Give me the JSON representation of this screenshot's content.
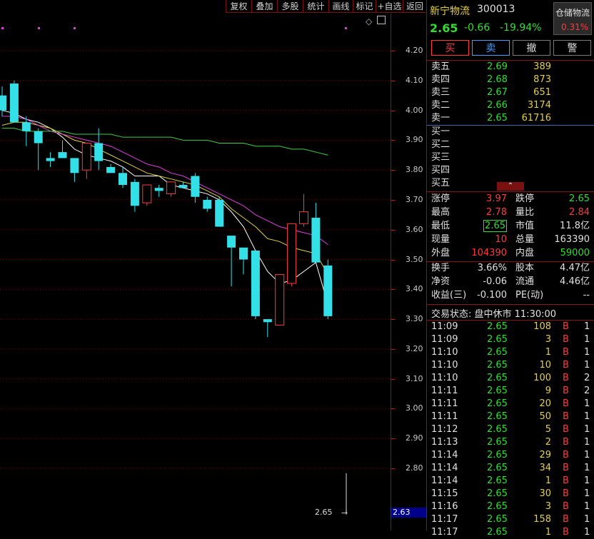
{
  "toolbar": {
    "items": [
      "复权",
      "叠加",
      "多股",
      "统计",
      "画线",
      "标记",
      "+自选",
      "返回"
    ]
  },
  "axis": {
    "labels": [
      "4.20",
      "4.10",
      "4.00",
      "3.90",
      "3.80",
      "3.70",
      "3.60",
      "3.50",
      "3.40",
      "3.30",
      "3.20",
      "3.10",
      "3.00",
      "2.90",
      "2.80"
    ],
    "current_price": "2.63",
    "last_close_marker": "2.65"
  },
  "quote": {
    "name": "新宁物流",
    "code": "300013",
    "price": "2.65",
    "change": "-0.66",
    "change_pct": "-19.94%",
    "sector": "仓储物流",
    "sector_pct": "0.31%",
    "buttons": [
      "买",
      "卖",
      "撤",
      "警"
    ]
  },
  "asks": [
    {
      "label": "卖五",
      "price": "2.69",
      "vol": "389"
    },
    {
      "label": "卖四",
      "price": "2.68",
      "vol": "873"
    },
    {
      "label": "卖三",
      "price": "2.67",
      "vol": "651"
    },
    {
      "label": "卖二",
      "price": "2.66",
      "vol": "3174"
    },
    {
      "label": "卖一",
      "price": "2.65",
      "vol": "61716"
    }
  ],
  "bids": [
    {
      "label": "买一"
    },
    {
      "label": "买二"
    },
    {
      "label": "买三"
    },
    {
      "label": "买四"
    },
    {
      "label": "买五"
    }
  ],
  "stats": {
    "limit_up_label": "涨停",
    "limit_up": "3.97",
    "limit_down_label": "跌停",
    "limit_down": "2.65",
    "high_label": "最高",
    "high": "2.78",
    "vol_ratio_label": "量比",
    "vol_ratio": "2.84",
    "low_label": "最低",
    "low": "2.65",
    "mktcap_label": "市值",
    "mktcap": "11.8亿",
    "cur_vol_label": "现量",
    "cur_vol": "10",
    "total_vol_label": "总量",
    "total_vol": "163390",
    "outer_label": "外盘",
    "outer": "104390",
    "inner_label": "内盘",
    "inner": "59000",
    "turnover_label": "换手",
    "turnover": "3.66%",
    "equity_label": "股本",
    "equity": "4.47亿",
    "nav_label": "净资",
    "nav": "-0.06",
    "float_label": "流通",
    "float": "4.46亿",
    "eps_label": "收益(三)",
    "eps": "-0.100",
    "pe_label": "PE(动)",
    "pe": "--"
  },
  "status_line": "交易状态: 盘中休市 11:30:00",
  "ticks": [
    {
      "t": "11:09",
      "p": "2.65",
      "v": "108",
      "s": "B",
      "n": "1"
    },
    {
      "t": "11:09",
      "p": "2.65",
      "v": "3",
      "s": "B",
      "n": "1"
    },
    {
      "t": "11:10",
      "p": "2.65",
      "v": "1",
      "s": "B",
      "n": "1"
    },
    {
      "t": "11:10",
      "p": "2.65",
      "v": "10",
      "s": "B",
      "n": "1"
    },
    {
      "t": "11:10",
      "p": "2.65",
      "v": "100",
      "s": "B",
      "n": "2"
    },
    {
      "t": "11:11",
      "p": "2.65",
      "v": "9",
      "s": "B",
      "n": "2"
    },
    {
      "t": "11:11",
      "p": "2.65",
      "v": "20",
      "s": "B",
      "n": "1"
    },
    {
      "t": "11:11",
      "p": "2.65",
      "v": "50",
      "s": "B",
      "n": "1"
    },
    {
      "t": "11:12",
      "p": "2.65",
      "v": "5",
      "s": "B",
      "n": "1"
    },
    {
      "t": "11:13",
      "p": "2.65",
      "v": "2",
      "s": "B",
      "n": "1"
    },
    {
      "t": "11:14",
      "p": "2.65",
      "v": "29",
      "s": "B",
      "n": "1"
    },
    {
      "t": "11:14",
      "p": "2.65",
      "v": "34",
      "s": "B",
      "n": "1"
    },
    {
      "t": "11:14",
      "p": "2.65",
      "v": "1",
      "s": "B",
      "n": "1"
    },
    {
      "t": "11:15",
      "p": "2.65",
      "v": "30",
      "s": "B",
      "n": "1"
    },
    {
      "t": "11:16",
      "p": "2.65",
      "v": "3",
      "s": "B",
      "n": "1"
    },
    {
      "t": "11:17",
      "p": "2.65",
      "v": "158",
      "s": "B",
      "n": "1"
    },
    {
      "t": "11:17",
      "p": "2.65",
      "v": "1",
      "s": "B",
      "n": "1"
    }
  ],
  "colors": {
    "up": "#ff3b3b",
    "down": "#33e0e8",
    "grid": "#8a1515",
    "ma5": "#ffffff",
    "ma10": "#e0d040",
    "ma20": "#e040e0",
    "ma60": "#40d040"
  },
  "chart_data": {
    "type": "candlestick",
    "ylim": [
      2.75,
      4.25
    ],
    "candles": [
      {
        "o": 4.05,
        "h": 4.08,
        "l": 3.98,
        "c": 4.0
      },
      {
        "o": 4.09,
        "h": 4.1,
        "l": 3.96,
        "c": 3.96
      },
      {
        "o": 3.96,
        "h": 3.98,
        "l": 3.88,
        "c": 3.93
      },
      {
        "o": 3.93,
        "h": 3.94,
        "l": 3.8,
        "c": 3.89
      },
      {
        "o": 3.84,
        "h": 3.86,
        "l": 3.81,
        "c": 3.83
      },
      {
        "o": 3.86,
        "h": 3.9,
        "l": 3.84,
        "c": 3.84
      },
      {
        "o": 3.84,
        "h": 3.84,
        "l": 3.76,
        "c": 3.79
      },
      {
        "o": 3.8,
        "h": 3.87,
        "l": 3.77,
        "c": 3.89
      },
      {
        "o": 3.89,
        "h": 3.94,
        "l": 3.8,
        "c": 3.83
      },
      {
        "o": 3.81,
        "h": 3.82,
        "l": 3.79,
        "c": 3.79
      },
      {
        "o": 3.79,
        "h": 3.81,
        "l": 3.74,
        "c": 3.75
      },
      {
        "o": 3.76,
        "h": 3.77,
        "l": 3.66,
        "c": 3.68
      },
      {
        "o": 3.69,
        "h": 3.75,
        "l": 3.68,
        "c": 3.75
      },
      {
        "o": 3.74,
        "h": 3.75,
        "l": 3.71,
        "c": 3.73
      },
      {
        "o": 3.72,
        "h": 3.76,
        "l": 3.71,
        "c": 3.76
      },
      {
        "o": 3.75,
        "h": 3.76,
        "l": 3.74,
        "c": 3.74
      },
      {
        "o": 3.78,
        "h": 3.79,
        "l": 3.69,
        "c": 3.71
      },
      {
        "o": 3.7,
        "h": 3.71,
        "l": 3.66,
        "c": 3.67
      },
      {
        "o": 3.7,
        "h": 3.71,
        "l": 3.61,
        "c": 3.61
      },
      {
        "o": 3.58,
        "h": 3.58,
        "l": 3.41,
        "c": 3.54
      },
      {
        "o": 3.54,
        "h": 3.54,
        "l": 3.45,
        "c": 3.5
      },
      {
        "o": 3.53,
        "h": 3.53,
        "l": 3.3,
        "c": 3.31
      },
      {
        "o": 3.3,
        "h": 3.3,
        "l": 3.24,
        "c": 3.29
      },
      {
        "o": 3.28,
        "h": 3.44,
        "l": 3.28,
        "c": 3.45
      },
      {
        "o": 3.42,
        "h": 3.62,
        "l": 3.41,
        "c": 3.62
      },
      {
        "o": 3.62,
        "h": 3.72,
        "l": 3.61,
        "c": 3.66
      },
      {
        "o": 3.64,
        "h": 3.69,
        "l": 3.49,
        "c": 3.49
      },
      {
        "o": 3.48,
        "h": 3.5,
        "l": 3.3,
        "c": 3.31
      }
    ],
    "ma_series": [
      {
        "name": "ma5",
        "values": [
          4.0,
          3.99,
          3.97,
          3.96,
          3.94,
          3.91,
          3.87,
          3.85,
          3.84,
          3.83,
          3.81,
          3.78,
          3.78,
          3.78,
          3.75,
          3.74,
          3.73,
          3.72,
          3.7,
          3.66,
          3.61,
          3.53,
          3.46,
          3.42,
          3.43,
          3.46,
          3.49,
          3.35
        ]
      },
      {
        "name": "ma10",
        "values": [
          3.95,
          3.96,
          3.96,
          3.95,
          3.94,
          3.92,
          3.9,
          3.89,
          3.87,
          3.85,
          3.83,
          3.81,
          3.79,
          3.78,
          3.77,
          3.76,
          3.75,
          3.73,
          3.71,
          3.67,
          3.64,
          3.61,
          3.57,
          3.56,
          3.54,
          3.53,
          3.52,
          3.45
        ]
      },
      {
        "name": "ma20",
        "values": [
          3.98,
          3.98,
          3.97,
          3.95,
          3.93,
          3.92,
          3.91,
          3.9,
          3.89,
          3.88,
          3.86,
          3.84,
          3.82,
          3.81,
          3.79,
          3.78,
          3.76,
          3.74,
          3.72,
          3.7,
          3.68,
          3.65,
          3.63,
          3.61,
          3.6,
          3.59,
          3.58,
          3.55
        ]
      },
      {
        "name": "ma60",
        "values": [
          3.94,
          3.94,
          3.93,
          3.93,
          3.93,
          3.93,
          3.92,
          3.92,
          3.92,
          3.92,
          3.91,
          3.91,
          3.91,
          3.91,
          3.91,
          3.9,
          3.9,
          3.9,
          3.89,
          3.89,
          3.89,
          3.88,
          3.88,
          3.88,
          3.87,
          3.87,
          3.86,
          3.85
        ]
      }
    ]
  }
}
